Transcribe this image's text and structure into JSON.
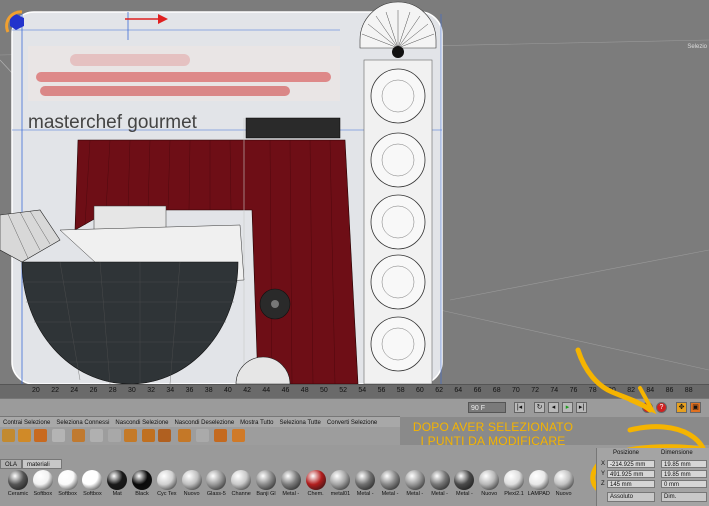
{
  "viewport": {
    "corner_label": "Selezio",
    "brand_text": "masterchef gourmet"
  },
  "annotation": {
    "line1": "DOPO AVER SELEZIONATO",
    "line2": "I PUNTI DA MODIFICARE"
  },
  "timeline": {
    "ticks": [
      "20",
      "22",
      "24",
      "26",
      "28",
      "30",
      "32",
      "34",
      "36",
      "38",
      "40",
      "42",
      "44",
      "46",
      "48",
      "50",
      "52",
      "54",
      "56",
      "58",
      "60",
      "62",
      "64",
      "66",
      "68",
      "70",
      "72",
      "74",
      "76",
      "78",
      "80",
      "82",
      "84",
      "86",
      "88"
    ]
  },
  "transport": {
    "frame_value": "90 F"
  },
  "menu": {
    "items": [
      "Contrai Selezione",
      "Seleziona Connessi",
      "Nascondi Selezione",
      "Nascondi Deselezione",
      "Mostra Tutto",
      "Seleziona Tutte",
      "Converti Selezione"
    ]
  },
  "tabs": {
    "left": "OLA",
    "materials": "materiali"
  },
  "materials": [
    {
      "label": "Ceramic",
      "color": "#555555"
    },
    {
      "label": "Softbox",
      "color": "#f2f2f2"
    },
    {
      "label": "Softbox",
      "color": "#fafafa"
    },
    {
      "label": "Softbox",
      "color": "#ffffff"
    },
    {
      "label": "Mat",
      "color": "#1a1a1a"
    },
    {
      "label": "Black",
      "color": "#0a0a0a"
    },
    {
      "label": "Cyc Tex",
      "color": "#d0d0d0"
    },
    {
      "label": "Nuovo",
      "color": "#bfbfbf"
    },
    {
      "label": "Glass-5",
      "color": "#9a9a9a"
    },
    {
      "label": "Channe",
      "color": "#c9c9c9"
    },
    {
      "label": "Banji Gl",
      "color": "#8b8b8b"
    },
    {
      "label": "Metal -",
      "color": "#7d7d7d"
    },
    {
      "label": "Chem.",
      "color": "#b21e1e"
    },
    {
      "label": "metal01",
      "color": "#a5a5a5"
    },
    {
      "label": "Metal -",
      "color": "#6f6f6f"
    },
    {
      "label": "Metal -",
      "color": "#888888"
    },
    {
      "label": "Metal -",
      "color": "#999999"
    },
    {
      "label": "Metal -",
      "color": "#777777"
    },
    {
      "label": "Metal -",
      "color": "#4a4a4a"
    },
    {
      "label": "Nuovo",
      "color": "#b8b8b8"
    },
    {
      "label": "Plexi2.1",
      "color": "#dddddd"
    },
    {
      "label": "LAMPAD",
      "color": "#e8e8e8"
    },
    {
      "label": "Nuovo",
      "color": "#c2c2c2"
    }
  ],
  "coords": {
    "position_header": "Posizione",
    "size_header": "Dimensione",
    "rows": [
      {
        "axis": "X",
        "position": "-214.925 mm",
        "size": "19.85 mm"
      },
      {
        "axis": "Y",
        "position": "491.925 mm",
        "size": "19.85 mm"
      },
      {
        "axis": "Z",
        "position": "145 mm",
        "size": "0 mm"
      }
    ],
    "mode_select": "Assoluto",
    "size_select": "Dim."
  },
  "colors": {
    "annotation": "#f5b400",
    "machine_red": "#6e0e16",
    "accent_red": "#c81e1e"
  }
}
